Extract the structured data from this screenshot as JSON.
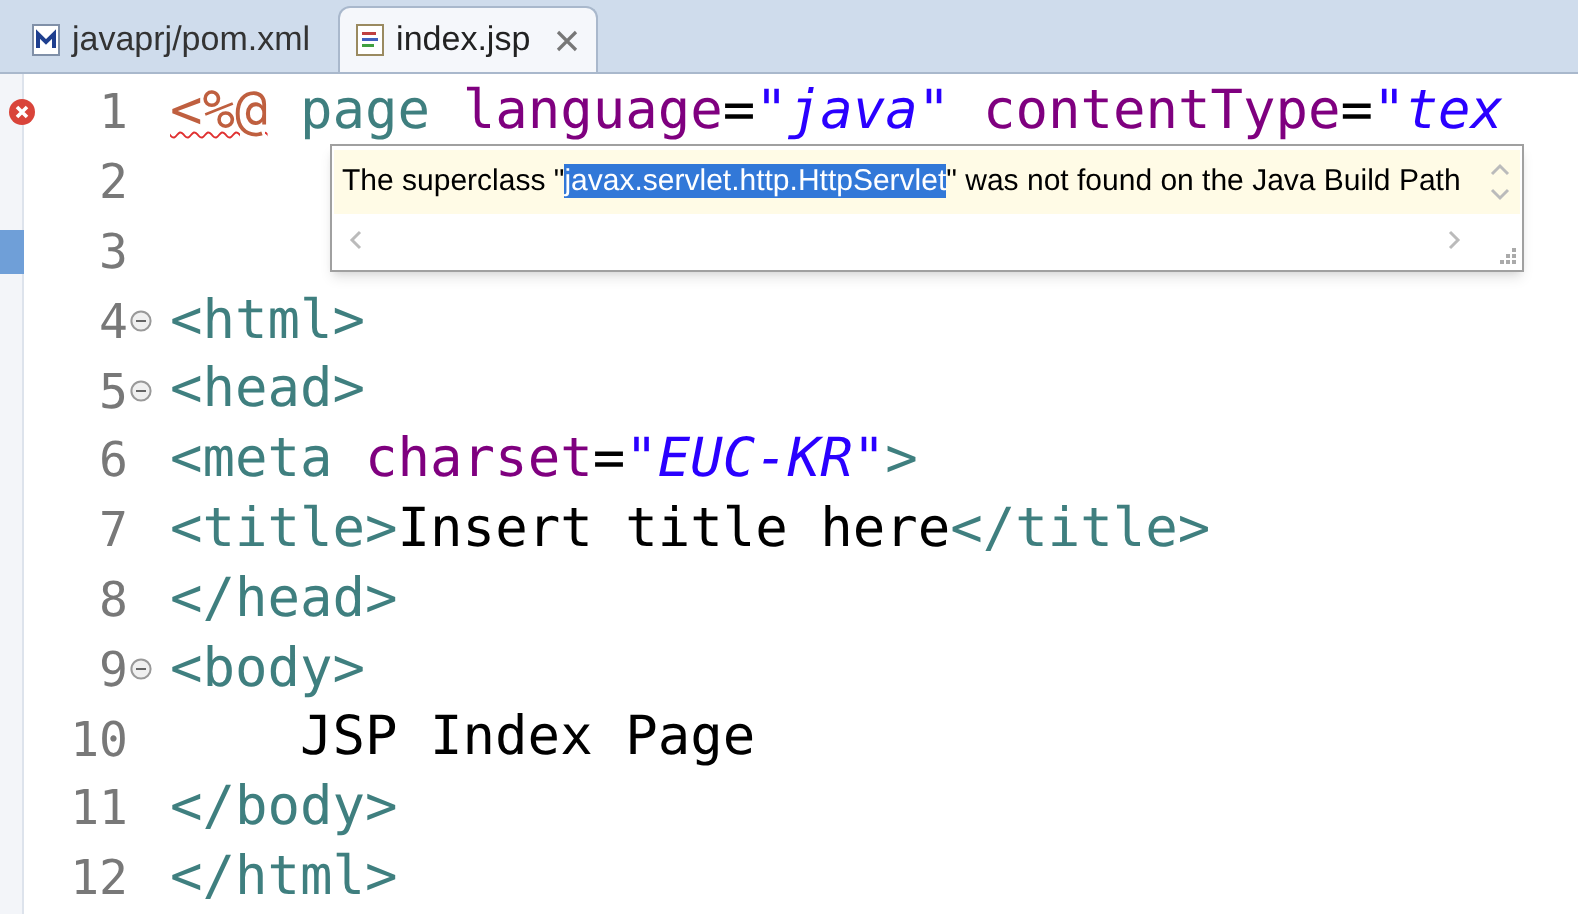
{
  "tabs": [
    {
      "label": "javaprj/pom.xml",
      "selected": false
    },
    {
      "label": "index.jsp",
      "selected": true
    }
  ],
  "editor": {
    "lines": [
      {
        "number": "1",
        "error": true,
        "fold": false,
        "marked": false,
        "tokens": [
          {
            "kind": "directive",
            "text": "<%@"
          },
          {
            "kind": "tag",
            "text": " page"
          },
          {
            "kind": "attr",
            "text": " language"
          },
          {
            "kind": "eq",
            "text": "="
          },
          {
            "kind": "string",
            "text": "\"java\""
          },
          {
            "kind": "attr",
            "text": " contentType"
          },
          {
            "kind": "eq",
            "text": "="
          },
          {
            "kind": "string",
            "text": "\"tex"
          }
        ]
      },
      {
        "number": "2",
        "error": false,
        "fold": false,
        "marked": false
      },
      {
        "number": "3",
        "error": false,
        "fold": false,
        "marked": true
      },
      {
        "number": "4",
        "error": false,
        "fold": true,
        "marked": false,
        "tokens": [
          {
            "kind": "tag",
            "text": "<html>"
          }
        ]
      },
      {
        "number": "5",
        "error": false,
        "fold": true,
        "marked": false,
        "tokens": [
          {
            "kind": "tag",
            "text": "<head>"
          }
        ]
      },
      {
        "number": "6",
        "error": false,
        "fold": false,
        "marked": false,
        "tokens": [
          {
            "kind": "tag",
            "text": "<meta"
          },
          {
            "kind": "attr",
            "text": " charset"
          },
          {
            "kind": "eq",
            "text": "="
          },
          {
            "kind": "string",
            "text": "\"EUC-KR\""
          },
          {
            "kind": "tag",
            "text": ">"
          }
        ]
      },
      {
        "number": "7",
        "error": false,
        "fold": false,
        "marked": false,
        "tokens": [
          {
            "kind": "tag",
            "text": "<title>"
          },
          {
            "kind": "text",
            "text": "Insert title here"
          },
          {
            "kind": "tag",
            "text": "</title>"
          }
        ]
      },
      {
        "number": "8",
        "error": false,
        "fold": false,
        "marked": false,
        "tokens": [
          {
            "kind": "tag",
            "text": "</head>"
          }
        ]
      },
      {
        "number": "9",
        "error": false,
        "fold": true,
        "marked": false,
        "tokens": [
          {
            "kind": "tag",
            "text": "<body>"
          }
        ]
      },
      {
        "number": "10",
        "error": false,
        "fold": false,
        "marked": false,
        "tokens": [
          {
            "kind": "text",
            "text": "    JSP Index Page"
          }
        ]
      },
      {
        "number": "11",
        "error": false,
        "fold": false,
        "marked": false,
        "tokens": [
          {
            "kind": "tag",
            "text": "</body>"
          }
        ]
      },
      {
        "number": "12",
        "error": false,
        "fold": false,
        "marked": false,
        "tokens": [
          {
            "kind": "tag",
            "text": "</html>"
          }
        ]
      }
    ]
  },
  "hover_popup": {
    "before": "The superclass \"",
    "selection": "javax.servlet.http.HttpServlet",
    "after": "\" was not found on the Java Build Path"
  }
}
